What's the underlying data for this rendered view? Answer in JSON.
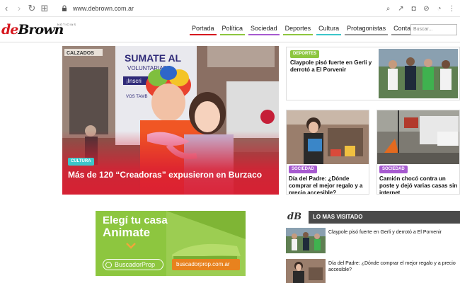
{
  "browser": {
    "url": "www.debrown.com.ar"
  },
  "site": {
    "logo_de": "de",
    "logo_brown": "Brown",
    "logo_sup": "NOTICIAS",
    "menu": [
      {
        "label": "Portada",
        "color": "#d6181f"
      },
      {
        "label": "Política",
        "color": "#8dc63f"
      },
      {
        "label": "Sociedad",
        "color": "#a75ad0"
      },
      {
        "label": "Deportes",
        "color": "#8dc63f"
      },
      {
        "label": "Cultura",
        "color": "#3cc6c9"
      },
      {
        "label": "Protagonistas",
        "color": "#999999"
      },
      {
        "label": "Contacto",
        "color": "#999999"
      }
    ],
    "search_placeholder": "Buscar..."
  },
  "hero": {
    "badge": "CULTURA",
    "title": "Más de 120 “Creadoras” expusieron en Burzaco",
    "sign_line1": "SUMATE AL",
    "sign_line2": "VOLUNTARIADO",
    "sign_line3": "¡Inscri",
    "sign_line4": "VOS TAMB",
    "shop_sign": "CALZADOS"
  },
  "cards": {
    "top": {
      "badge": "DEPORTES",
      "title": "Claypole pisó fuerte en Gerli y derrotó a El Porvenir"
    },
    "left": {
      "badge": "SOCIEDAD",
      "title": "Día del Padre: ¿Dónde comprar el mejor regalo y a precio accesible?"
    },
    "right": {
      "badge": "SOCIEDAD",
      "title": "Camión chocó contra un poste y dejó varias casas sin internet"
    }
  },
  "ad": {
    "line1": "Elegí tu casa",
    "line2": "Animate",
    "brand": "BuscadorProp",
    "url": "buscadorprop.com.ar"
  },
  "most_visited": {
    "logo": "dB",
    "title": "LO MAS VISITADO",
    "items": [
      {
        "title": "Claypole pisó fuerte en Gerli y derrotó a El Porvenir"
      },
      {
        "title": "Día del Padre: ¿Dónde comprar el mejor regalo y a precio accesible?"
      }
    ]
  },
  "colors": {
    "brand_red": "#d6181f",
    "cultura": "#3cc6c9",
    "deportes": "#8dc63f",
    "sociedad": "#a75ad0"
  }
}
